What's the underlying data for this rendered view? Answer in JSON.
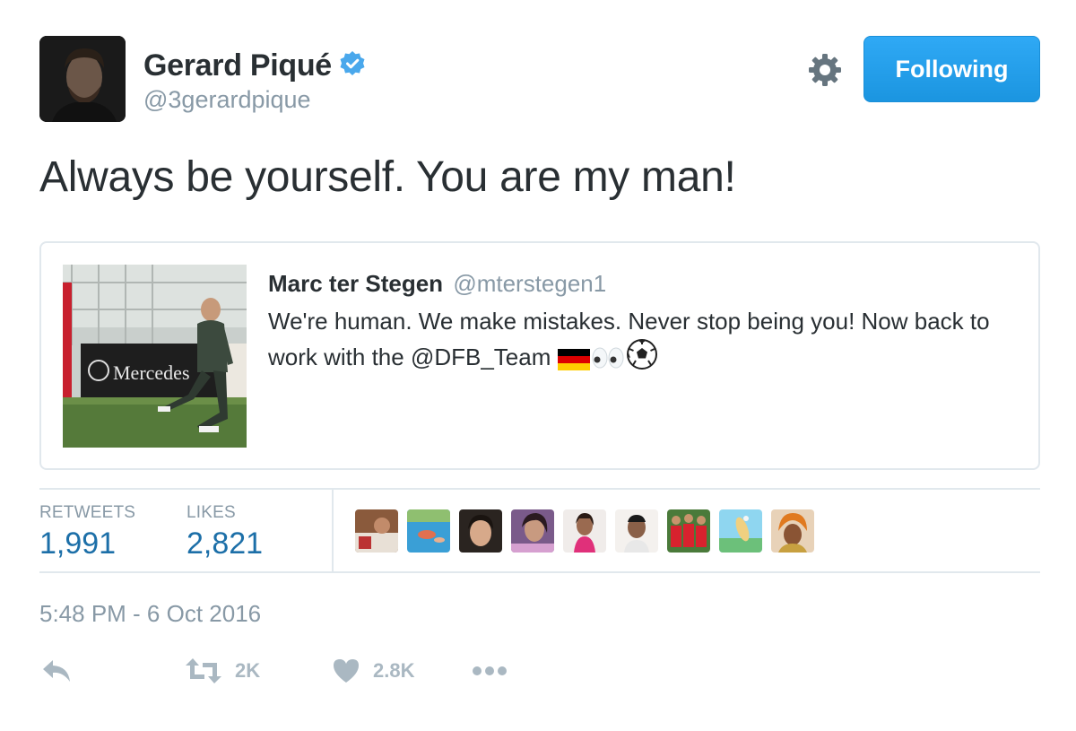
{
  "author": {
    "name": "Gerard Piqué",
    "handle": "@3gerardpique",
    "verified": true
  },
  "header": {
    "follow_label": "Following",
    "settings_icon": "gear-icon"
  },
  "tweet": {
    "text": "Always be yourself. You are my man!",
    "timestamp": "5:48 PM - 6 Oct 2016"
  },
  "quote": {
    "name": "Marc ter Stegen",
    "handle": "@mterstegen1",
    "text": "We're human. We make mistakes. Never stop being you! Now back to work with the @DFB_Team",
    "emojis": [
      "german-flag-icon",
      "eyes-icon",
      "soccer-ball-icon"
    ],
    "image_banner_text": "Mercedes"
  },
  "stats": {
    "retweets_label": "RETWEETS",
    "retweets_value": "1,991",
    "likes_label": "LIKES",
    "likes_value": "2,821"
  },
  "actions": {
    "reply_icon": "reply-icon",
    "retweet_icon": "retweet-icon",
    "retweet_count": "2K",
    "like_icon": "heart-icon",
    "like_count": "2.8K",
    "more_icon": "more-icon"
  },
  "colors": {
    "accent": "#1da1f2",
    "stat_blue": "#1c6fa8",
    "muted": "#8899a6",
    "border": "#e1e8ed",
    "action_gray": "#aab8c2"
  }
}
